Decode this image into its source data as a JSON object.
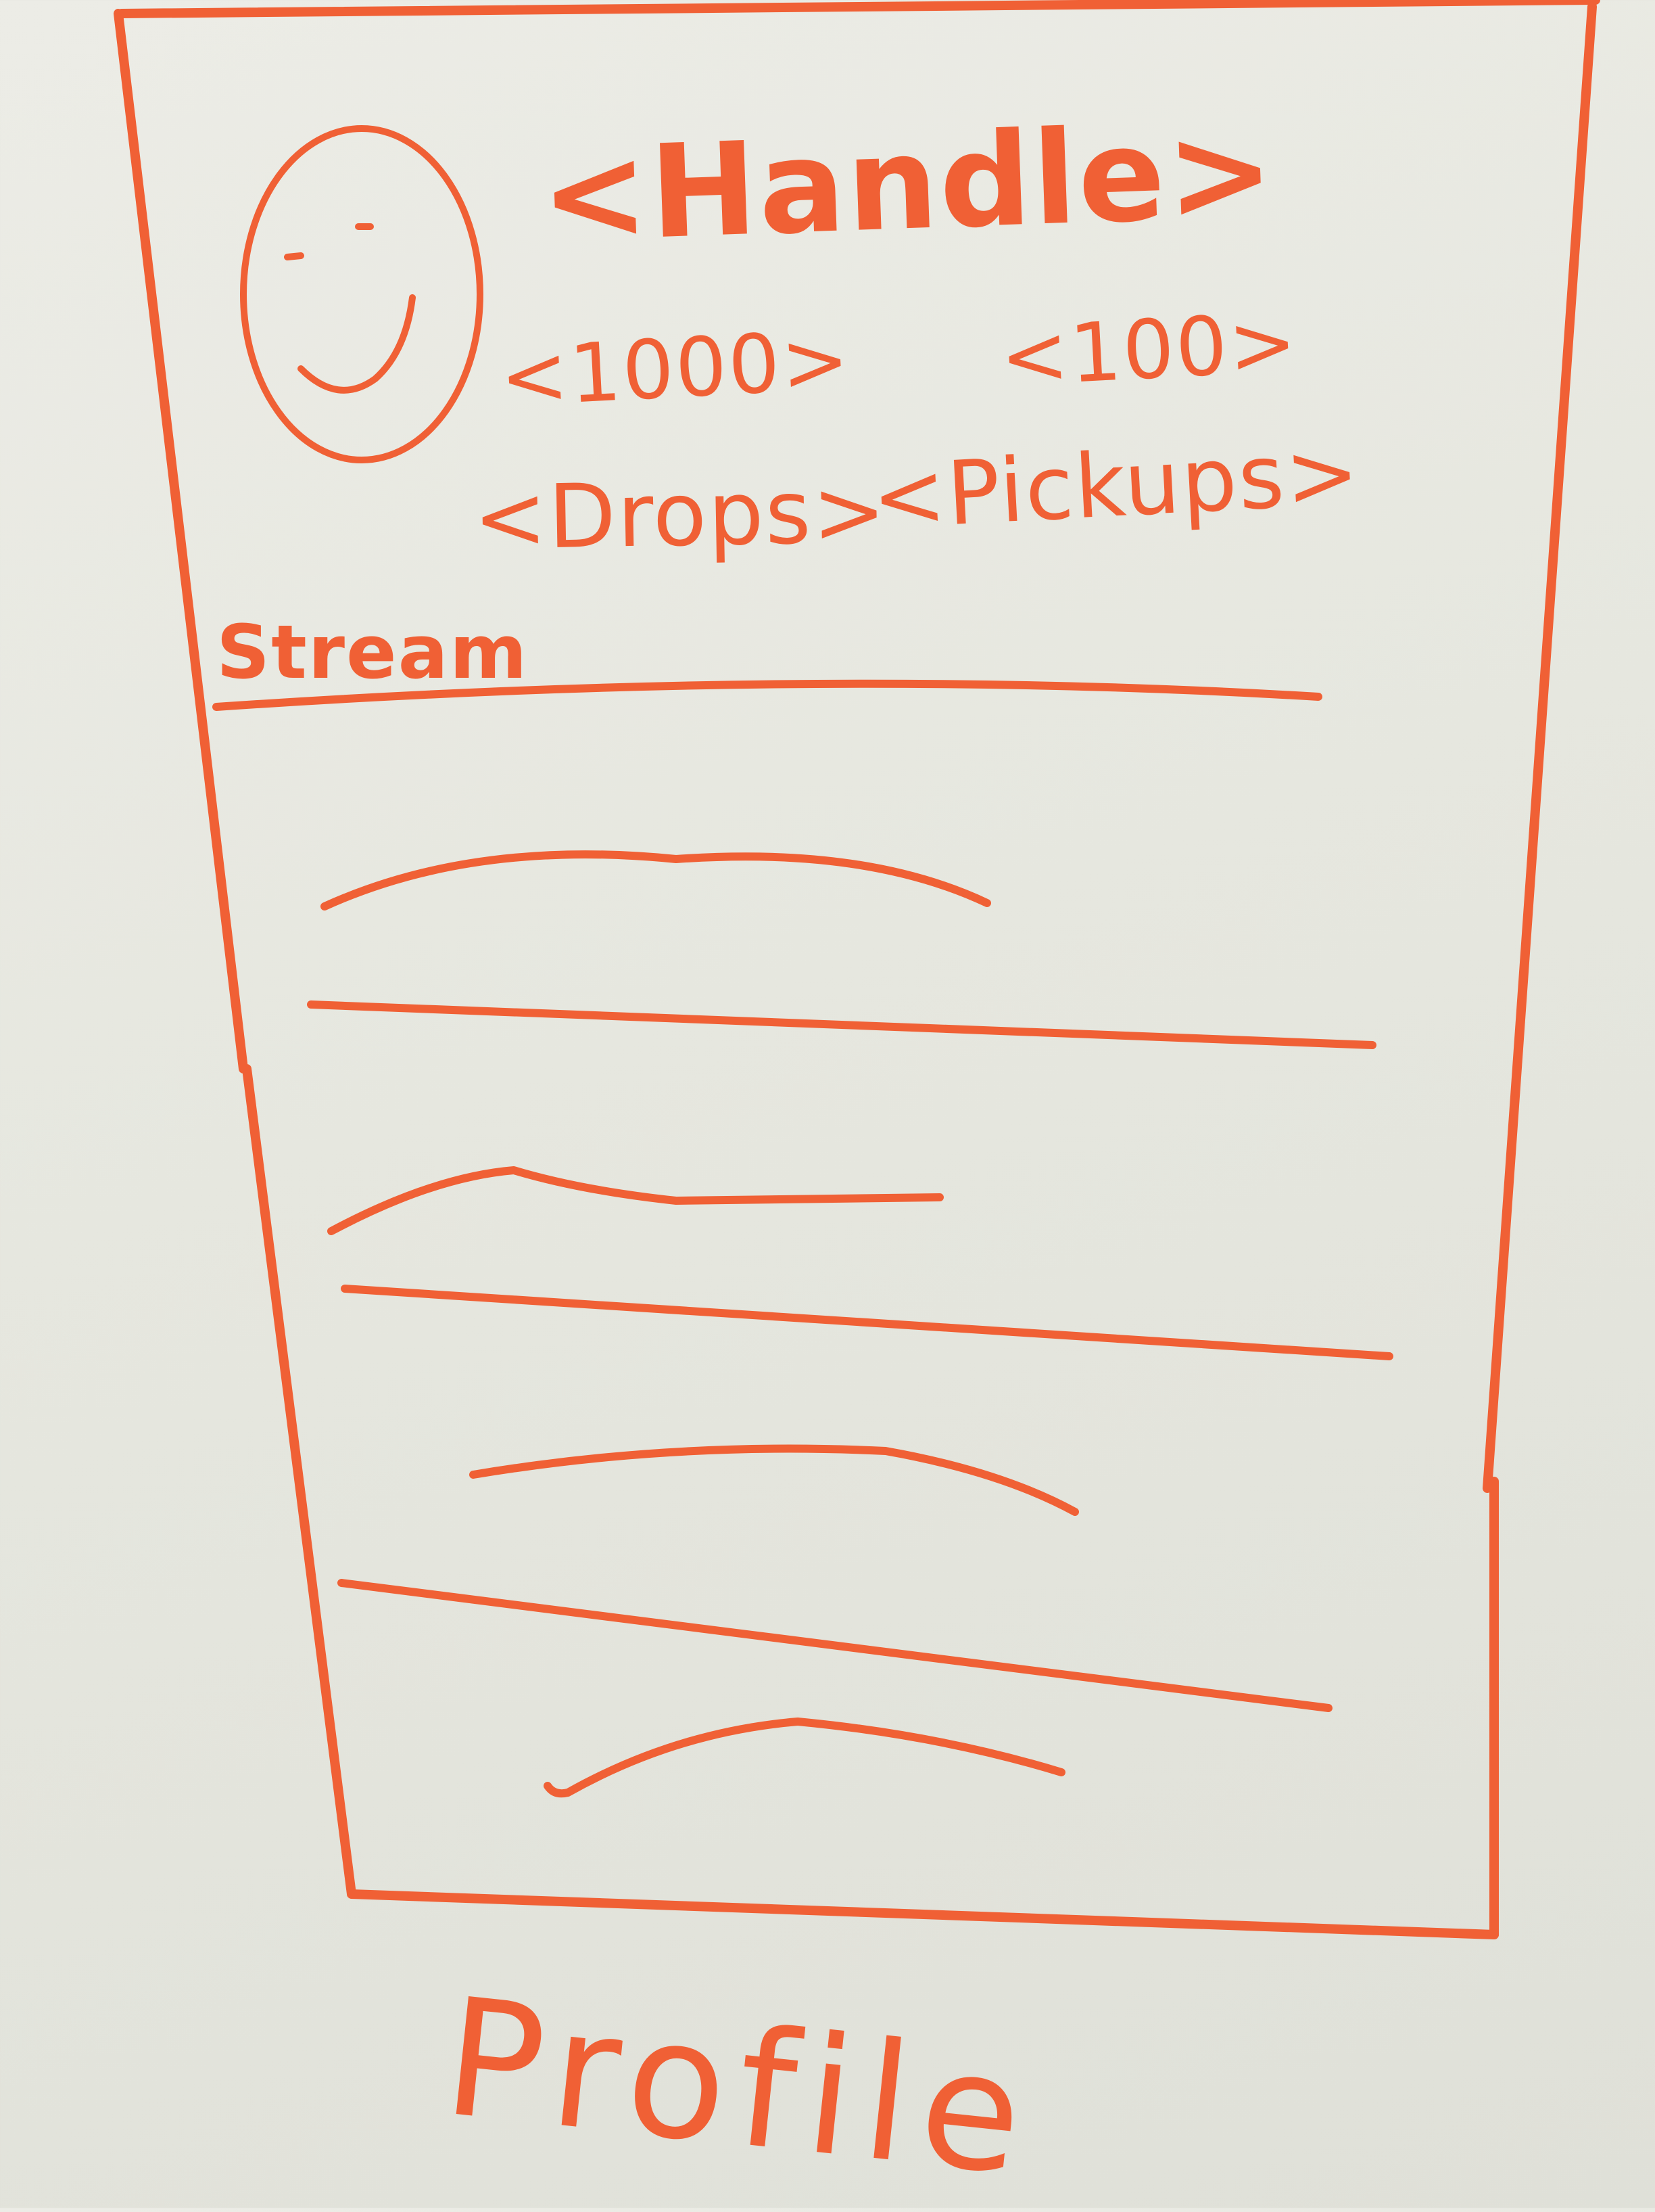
{
  "ink_color": "#f06035",
  "board_color": "#e6e7df",
  "profile": {
    "handle": "<Handle>",
    "stat_a": "<1000>",
    "stat_b": "<100>",
    "drops": "<Drops>",
    "pickups": "<Pickups>"
  },
  "stream": {
    "label": "Stream",
    "item_count": 4
  },
  "caption": "Profile",
  "avatar_icon": "smiley-face-icon"
}
